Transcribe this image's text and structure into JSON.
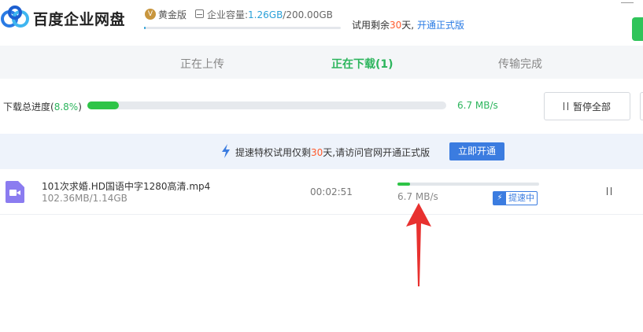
{
  "app": {
    "brand": "百度企业网盘",
    "tier": "黄金版",
    "storage_label": "企业容量:",
    "storage_used": "1.26GB",
    "storage_total": "/200.00GB",
    "storage_fraction": 0.0063,
    "trial_prefix": "试用剩余",
    "trial_days": "30",
    "trial_suffix": "天,",
    "upgrade_link": "开通正式版"
  },
  "tabs": [
    {
      "label": "正在上传",
      "active": false
    },
    {
      "label": "正在下载(1)",
      "active": true
    },
    {
      "label": "传输完成",
      "active": false
    }
  ],
  "total": {
    "label_prefix": "下载总进度(",
    "percent": "8.8%",
    "label_suffix": ")",
    "fraction": 0.088,
    "speed": "6.7 MB/s",
    "pause_all_label": "暂停全部"
  },
  "banner": {
    "text_prefix": "提速特权试用仅剩",
    "days": "30",
    "text_suffix": "天,请访问官网开通正式版",
    "button_label": "立即开通"
  },
  "downloads": [
    {
      "name": "101次求婚.HD国语中字1280高清.mp4",
      "size": "102.36MB/1.14GB",
      "time_remaining": "00:02:51",
      "progress_fraction": 0.088,
      "speed": "6.7 MB/s",
      "badge": "提速中",
      "icon": "video-icon"
    }
  ],
  "colors": {
    "accent_green": "#2db55d",
    "progress_green": "#2ec447",
    "accent_blue": "#3b7ce0",
    "trial_orange": "#ff5a2c",
    "annotation_red": "#e8312f"
  }
}
